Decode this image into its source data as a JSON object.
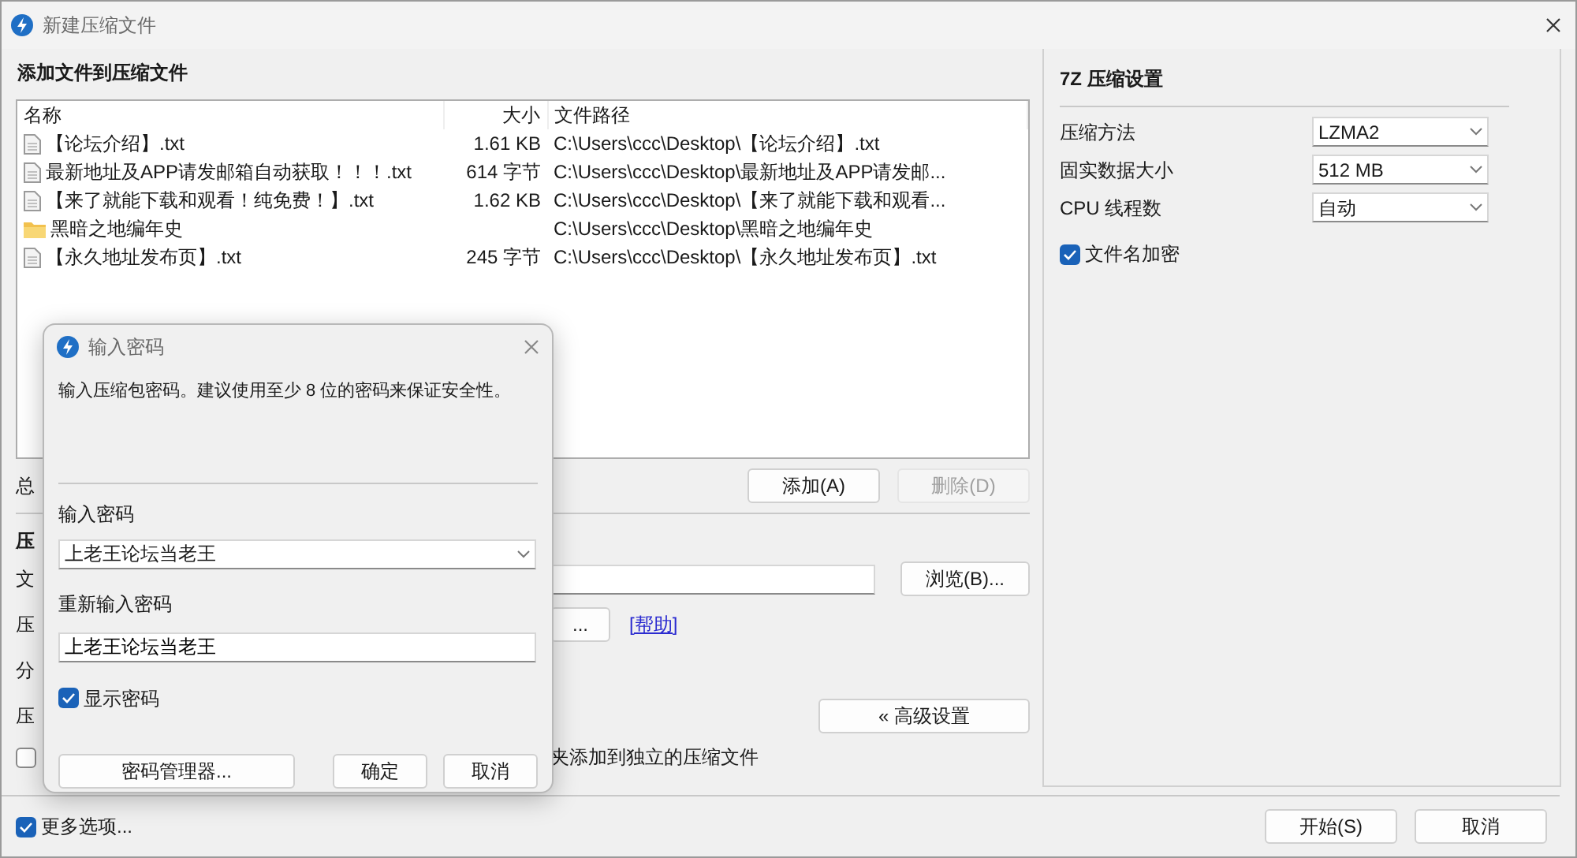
{
  "window": {
    "title": "新建压缩文件"
  },
  "files": {
    "heading": "添加文件到压缩文件",
    "columns": [
      "名称",
      "大小",
      "文件路径"
    ],
    "rows": [
      {
        "kind": "file",
        "name": "【论坛介绍】.txt",
        "size": "1.61 KB",
        "path": "C:\\Users\\ccc\\Desktop\\【论坛介绍】.txt"
      },
      {
        "kind": "file",
        "name": "最新地址及APP请发邮箱自动获取！！！.txt",
        "size": "614 字节",
        "path": "C:\\Users\\ccc\\Desktop\\最新地址及APP请发邮..."
      },
      {
        "kind": "file",
        "name": "【来了就能下载和观看！纯免费！】.txt",
        "size": "1.62 KB",
        "path": "C:\\Users\\ccc\\Desktop\\【来了就能下载和观看..."
      },
      {
        "kind": "folder",
        "name": "黑暗之地编年史",
        "path": "C:\\Users\\ccc\\Desktop\\黑暗之地编年史"
      },
      {
        "kind": "file",
        "name": "【永久地址发布页】.txt",
        "size": "245 字节",
        "path": "C:\\Users\\ccc\\Desktop\\【永久地址发布页】.txt"
      }
    ]
  },
  "list_actions": {
    "label": "总",
    "buttons": [
      {
        "label": "添加(A)",
        "disabled": false
      },
      {
        "label": "删除(D)",
        "disabled": true
      }
    ]
  },
  "archive": {
    "heading": "压",
    "file_label": "文",
    "browse_button": "浏览(B)...",
    "format_label": "压",
    "format_button": "...",
    "help_link": "[帮助]",
    "volume_label": "分",
    "level_label": "压",
    "advanced_button": "« 高级设置",
    "separate_option": {
      "label": "夹添加到独立的压缩文件",
      "checked": false
    }
  },
  "settings": {
    "heading": "7Z 压缩设置",
    "options": [
      {
        "label": "压缩方法",
        "value": "LZMA2"
      },
      {
        "label": "固实数据大小",
        "value": "512 MB"
      },
      {
        "label": "CPU 线程数",
        "value": "自动"
      }
    ],
    "encrypt_names": {
      "label": "文件名加密",
      "checked": true
    }
  },
  "footer": {
    "more_options": {
      "label": "更多选项...",
      "checked": true
    },
    "buttons": [
      "开始(S)",
      "取消"
    ]
  },
  "password_dialog": {
    "title": "输入密码",
    "message": "输入压缩包密码。建议使用至少 8 位的密码来保证安全性。",
    "password_label": "输入密码",
    "password": "上老王论坛当老王",
    "confirm_label": "重新输入密码",
    "confirm": "上老王论坛当老王",
    "show_password": {
      "label": "显示密码",
      "checked": true
    },
    "buttons": [
      "密码管理器...",
      "确定",
      "取消"
    ]
  }
}
